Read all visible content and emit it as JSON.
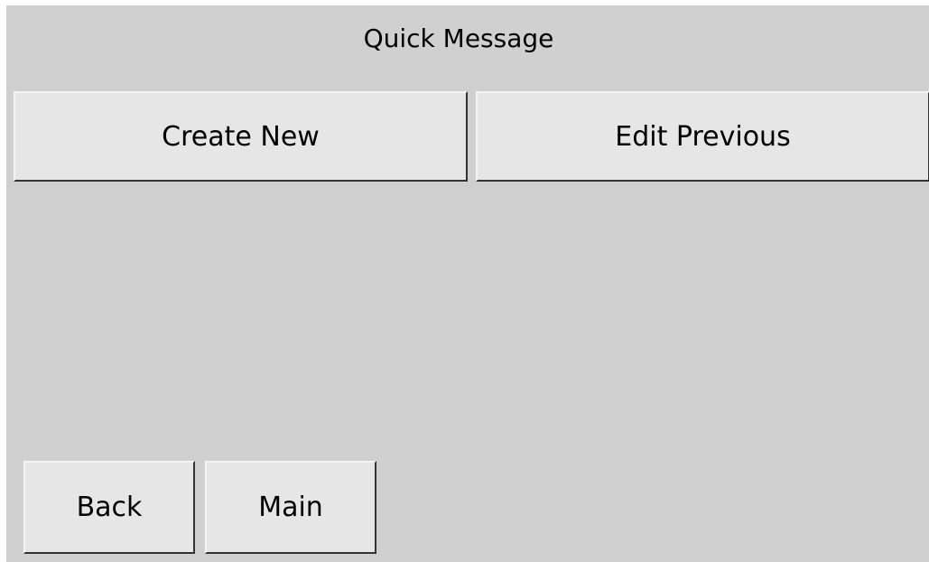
{
  "screen": {
    "title": "Quick Message"
  },
  "actions": {
    "create_new_label": "Create New",
    "edit_previous_label": "Edit Previous"
  },
  "nav": {
    "back_label": "Back",
    "main_label": "Main"
  },
  "colors": {
    "background": "#d0d0d0",
    "button_face": "#e6e6e6",
    "button_shadow": "#333333",
    "button_highlight": "#f4f4f4",
    "text": "#000000"
  }
}
